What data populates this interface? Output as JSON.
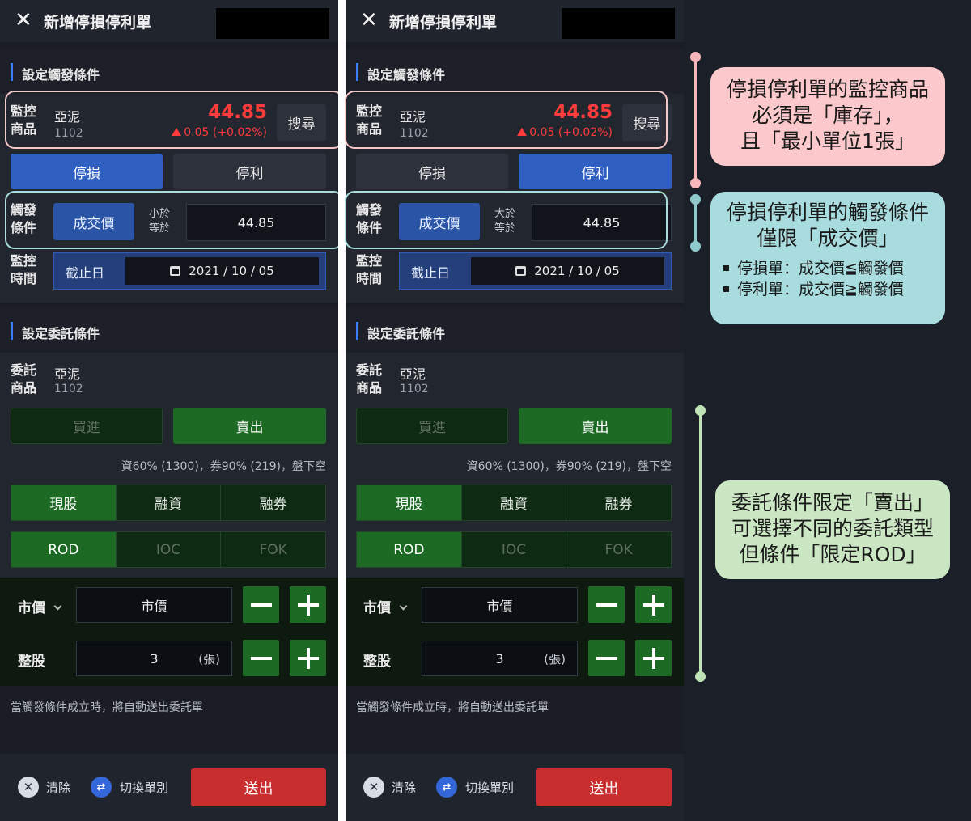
{
  "header": {
    "title": "新增停損停利單"
  },
  "trigger_section": {
    "title": "設定觸發條件",
    "product_label": [
      "監控",
      "商品"
    ],
    "product_name": "亞泥",
    "product_code": "1102",
    "price": "44.85",
    "change": "0.05 (+0.02%)",
    "search_label": "搜尋",
    "tabs": [
      "停損",
      "停利"
    ],
    "cond_label": [
      "觸發",
      "條件"
    ],
    "cond_type": "成交價",
    "cond_value": "44.85",
    "time_label": [
      "監控",
      "時間"
    ],
    "deadline_label": "截止日",
    "deadline_value": "2021 / 10 / 05"
  },
  "order_section": {
    "title": "設定委託條件",
    "product_label": [
      "委託",
      "商品"
    ],
    "product_name": "亞泥",
    "product_code": "1102",
    "buy_label": "買進",
    "sell_label": "賣出",
    "margin_info": "資60% (1300)，券90% (219)，盤下空",
    "trade_types": [
      "現股",
      "融資",
      "融券"
    ],
    "order_types": [
      "ROD",
      "IOC",
      "FOK"
    ],
    "price_type_label": "市價",
    "price_value": "市價",
    "lot_label": "整股",
    "qty_value": "3",
    "qty_unit": "(張)",
    "note": "當觸發條件成立時，將自動送出委託單"
  },
  "footer": {
    "clear_label": "清除",
    "switch_label": "切換單別",
    "submit_label": "送出"
  },
  "panels": [
    {
      "op_text": [
        "小於",
        "等於"
      ],
      "active_tab": "停損"
    },
    {
      "op_text": [
        "大於",
        "等於"
      ],
      "active_tab": "停利"
    }
  ],
  "annotations": {
    "pink": {
      "lines": [
        "停損停利單的監控商品",
        "必須是「庫存」，",
        "且「最小單位1張」"
      ]
    },
    "cyan": {
      "lines": [
        "停損停利單的觸發條件",
        "僅限「成交價」"
      ],
      "bullets": [
        "停損單：成交價≦觸發價",
        "停利單：成交價≧觸發價"
      ]
    },
    "green": {
      "lines": [
        "委託條件限定「賣出」",
        "可選擇不同的委託類型",
        "但條件「限定ROD」"
      ]
    }
  },
  "colors": {
    "accent_blue": "#2f5fc0",
    "green": "#1d6a24",
    "red_price": "#ff3b3b",
    "submit_red": "#c82e2e",
    "pink": "#fbc9cb",
    "cyan": "#a9dcde",
    "light_green": "#cbe6c3"
  }
}
